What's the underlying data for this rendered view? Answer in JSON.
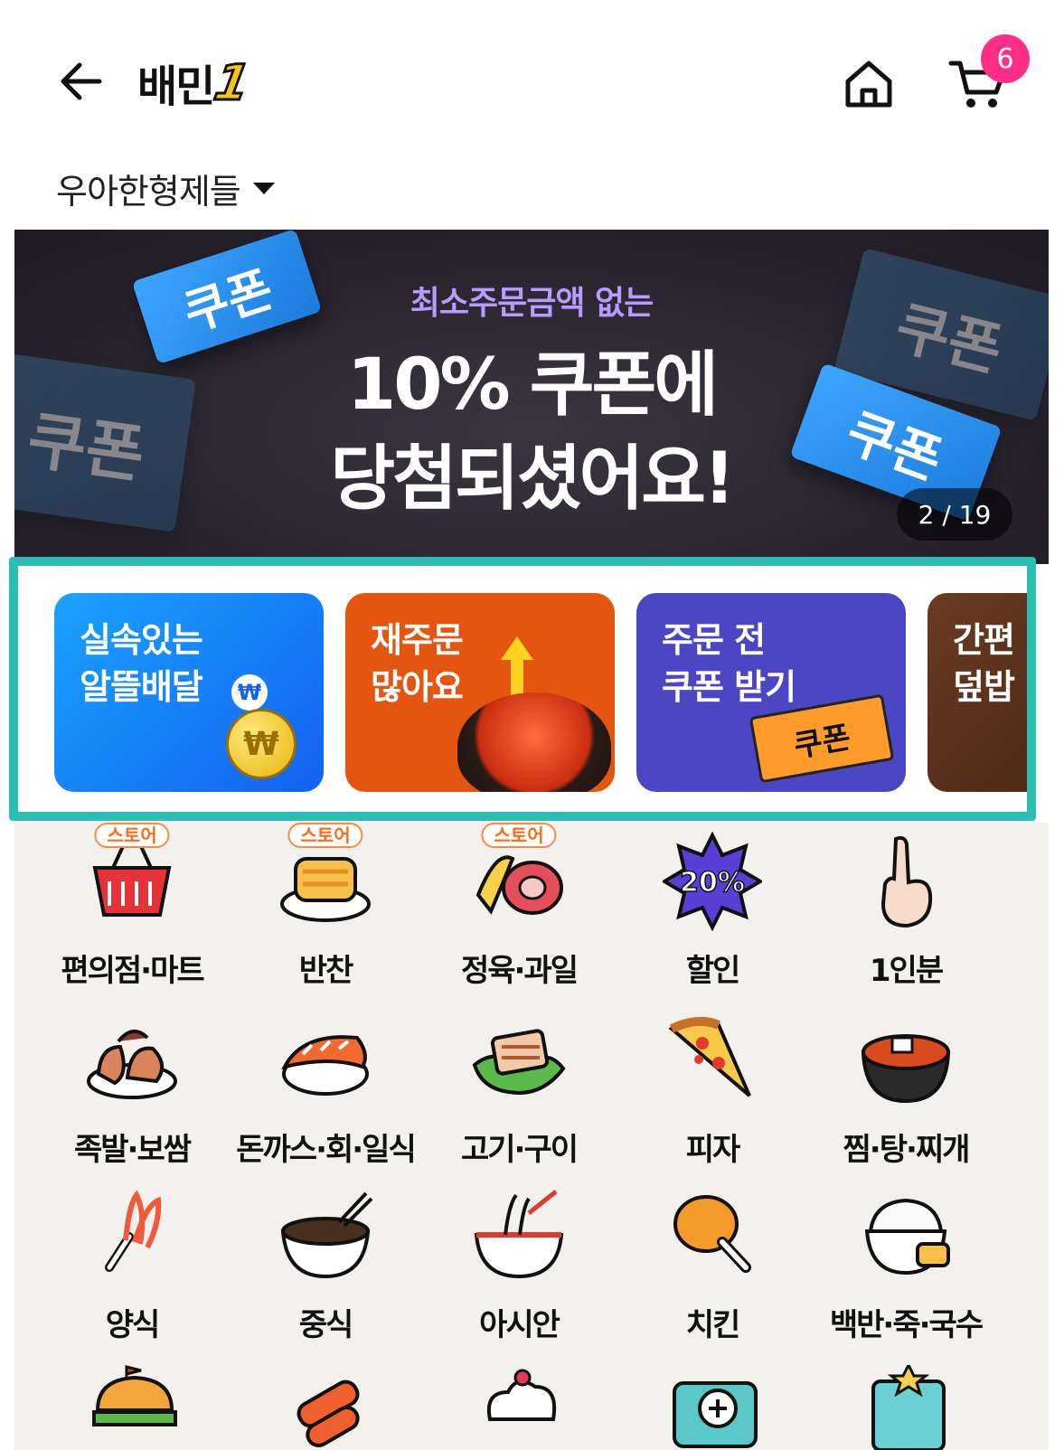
{
  "header": {
    "logo_text": "배민",
    "logo_badge": "1",
    "cart_count": "6"
  },
  "address": {
    "label": "우아한형제들"
  },
  "banner": {
    "subtitle": "최소주문금액 없는",
    "title_line1": "10% 쿠폰에",
    "title_line2": "당첨되셨어요!",
    "ticket_label": "쿠폰",
    "counter": "2 / 19"
  },
  "quick_cards": [
    {
      "line1": "실속있는",
      "line2": "알뜰배달",
      "deco": "₩"
    },
    {
      "line1": "재주문",
      "line2": "많아요"
    },
    {
      "line1": "주문 전",
      "line2": "쿠폰 받기",
      "deco": "쿠폰"
    },
    {
      "line1": "간편",
      "line2": "덮밥"
    }
  ],
  "store_tag": "스토어",
  "categories": [
    {
      "label": "편의점·마트",
      "icon": "basket-icon",
      "store": true
    },
    {
      "label": "반찬",
      "icon": "side-dish-icon",
      "store": true
    },
    {
      "label": "정육·과일",
      "icon": "meat-fruit-icon",
      "store": true
    },
    {
      "label": "할인",
      "icon": "discount-icon",
      "badge": "20%"
    },
    {
      "label": "1인분",
      "icon": "one-serving-icon"
    },
    {
      "label": "족발·보쌈",
      "icon": "jokbal-icon"
    },
    {
      "label": "돈까스·회·일식",
      "icon": "sushi-icon"
    },
    {
      "label": "고기·구이",
      "icon": "grilled-meat-icon"
    },
    {
      "label": "피자",
      "icon": "pizza-icon"
    },
    {
      "label": "찜·탕·찌개",
      "icon": "stew-icon"
    },
    {
      "label": "양식",
      "icon": "pasta-icon"
    },
    {
      "label": "중식",
      "icon": "noodle-bowl-icon"
    },
    {
      "label": "아시안",
      "icon": "pho-icon"
    },
    {
      "label": "치킨",
      "icon": "chicken-icon"
    },
    {
      "label": "백반·죽·국수",
      "icon": "rice-bowl-icon"
    }
  ],
  "colors": {
    "highlight": "#2bbfb3",
    "badge": "#ff2e86",
    "card_blue": "#1361f0",
    "card_orange": "#e4560f",
    "card_purple": "#4b47c4"
  }
}
